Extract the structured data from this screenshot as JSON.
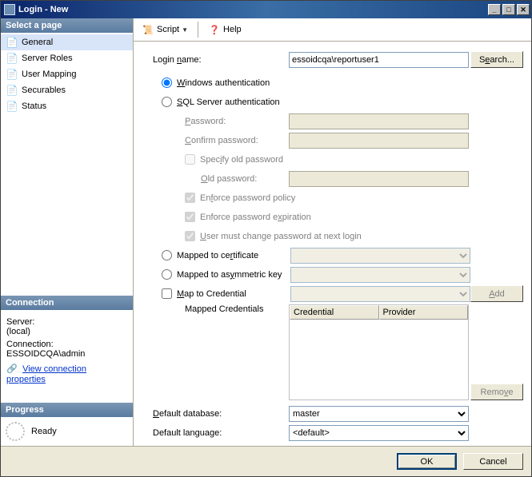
{
  "window": {
    "title": "Login - New"
  },
  "winbtns": {
    "min": "_",
    "max": "□",
    "close": "✕"
  },
  "left": {
    "select_page": "Select a page",
    "pages": [
      "General",
      "Server Roles",
      "User Mapping",
      "Securables",
      "Status"
    ],
    "connection_header": "Connection",
    "server_label": "Server:",
    "server_value": "(local)",
    "connection_label": "Connection:",
    "connection_value": "ESSOIDCQA\\admin",
    "view_props": "View connection properties",
    "progress_header": "Progress",
    "progress_status": "Ready"
  },
  "toolbar": {
    "script": "Script",
    "help": "Help"
  },
  "form": {
    "login_name_label": "Login name:",
    "login_name_value": "essoidcqa\\reportuser1",
    "search_btn": "Search...",
    "windows_auth": "Windows authentication",
    "sql_auth": "SQL Server authentication",
    "password_label": "Password:",
    "confirm_password_label": "Confirm password:",
    "specify_old": "Specify old password",
    "old_password_label": "Old password:",
    "enforce_policy": "Enforce password policy",
    "enforce_expiration": "Enforce password expiration",
    "must_change": "User must change password at next login",
    "mapped_cert": "Mapped to certificate",
    "mapped_asym": "Mapped to asymmetric key",
    "map_credential": "Map to Credential",
    "add_btn": "Add",
    "mapped_credentials_label": "Mapped Credentials",
    "credential_header": "Credential",
    "provider_header": "Provider",
    "remove_btn": "Remove",
    "default_db_label": "Default database:",
    "default_db_value": "master",
    "default_lang_label": "Default language:",
    "default_lang_value": "<default>"
  },
  "buttons": {
    "ok": "OK",
    "cancel": "Cancel"
  }
}
